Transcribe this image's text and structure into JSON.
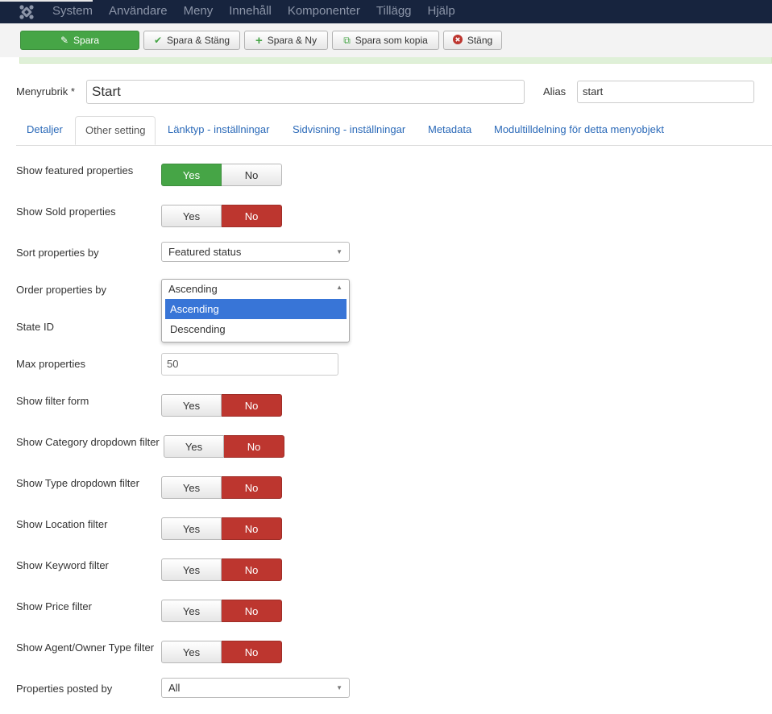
{
  "topnav": {
    "items": [
      "System",
      "Användare",
      "Meny",
      "Innehåll",
      "Komponenter",
      "Tillägg",
      "Hjälp"
    ]
  },
  "toolbar": {
    "save": "Spara",
    "save_close": "Spara & Stäng",
    "save_new": "Spara & Ny",
    "save_copy": "Spara som kopia",
    "close": "Stäng"
  },
  "title": {
    "label": "Menyrubrik *",
    "value": "Start"
  },
  "alias": {
    "label": "Alias",
    "value": "start"
  },
  "tabs": [
    "Detaljer",
    "Other setting",
    "Länktyp - inställningar",
    "Sidvisning - inställningar",
    "Metadata",
    "Modultilldelning för detta menyobjekt"
  ],
  "fields": {
    "featured": {
      "label": "Show featured properties",
      "yes": "Yes",
      "no": "No",
      "value": "Yes"
    },
    "sold": {
      "label": "Show Sold properties",
      "yes": "Yes",
      "no": "No",
      "value": "No"
    },
    "sort_by": {
      "label": "Sort properties by",
      "value": "Featured status"
    },
    "order_by": {
      "label": "Order properties by",
      "value": "Ascending",
      "options": [
        "Ascending",
        "Descending"
      ]
    },
    "state": {
      "label": "State ID"
    },
    "max": {
      "label": "Max properties",
      "value": "50"
    },
    "filter_form": {
      "label": "Show filter form",
      "yes": "Yes",
      "no": "No",
      "value": "No"
    },
    "category": {
      "label": "Show Category dropdown filter",
      "yes": "Yes",
      "no": "No",
      "value": "No"
    },
    "type": {
      "label": "Show Type dropdown filter",
      "yes": "Yes",
      "no": "No",
      "value": "No"
    },
    "location": {
      "label": "Show Location filter",
      "yes": "Yes",
      "no": "No",
      "value": "No"
    },
    "keyword": {
      "label": "Show Keyword filter",
      "yes": "Yes",
      "no": "No",
      "value": "No"
    },
    "price": {
      "label": "Show Price filter",
      "yes": "Yes",
      "no": "No",
      "value": "No"
    },
    "agent": {
      "label": "Show Agent/Owner Type filter",
      "yes": "Yes",
      "no": "No",
      "value": "No"
    },
    "posted_by": {
      "label": "Properties posted by",
      "value": "All"
    }
  },
  "colors": {
    "nav_bg": "#17243e",
    "save_green": "#46a546",
    "no_red": "#bd362f",
    "link_blue": "#2a69b8",
    "option_highlight": "#3875d7"
  }
}
